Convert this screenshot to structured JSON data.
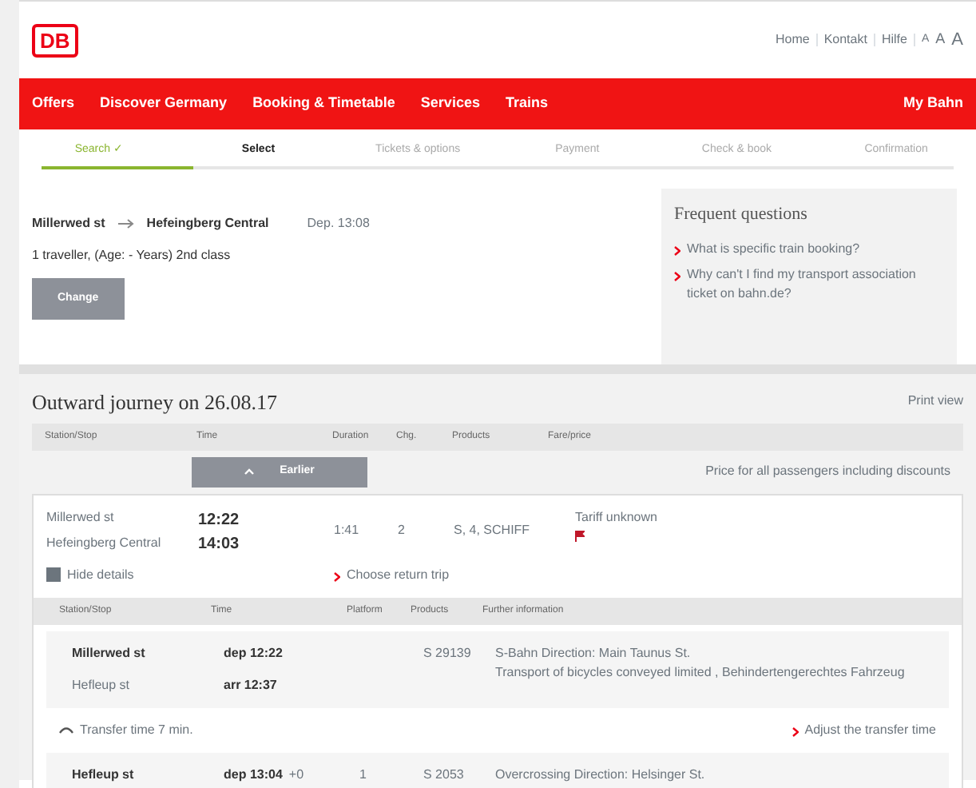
{
  "header": {
    "logo": "DB",
    "links": [
      "Home",
      "Kontakt",
      "Hilfe"
    ],
    "font_sizes": [
      "A",
      "A",
      "A"
    ]
  },
  "nav": {
    "items": [
      "Offers",
      "Discover Germany",
      "Booking & Timetable",
      "Services",
      "Trains"
    ],
    "account": "My Bahn"
  },
  "steps": [
    {
      "label": "Search",
      "done": true,
      "selected": false,
      "check": "✓"
    },
    {
      "label": "Select",
      "done": false,
      "selected": true
    },
    {
      "label": "Tickets & options",
      "done": false,
      "selected": false
    },
    {
      "label": "Payment",
      "done": false,
      "selected": false
    },
    {
      "label": "Check & book",
      "done": false,
      "selected": false
    },
    {
      "label": "Confirmation",
      "done": false,
      "selected": false
    }
  ],
  "summary": {
    "from": "Millerwed st",
    "to": "Hefeingberg Central",
    "departure": "Dep. 13:08",
    "travellers": "1 traveller, (Age: - Years) 2nd class",
    "button": "Change"
  },
  "faq": {
    "title": "Frequent questions",
    "items": [
      "What is specific train booking?",
      "Why can't I find my transport association ticket on bahn.de?"
    ]
  },
  "journey": {
    "title": "Outward journey on 26.08.17",
    "print": "Print view",
    "columns": [
      "Station/Stop",
      "Time",
      "Duration",
      "Chg.",
      "Products",
      "Fare/price"
    ],
    "earlier": "Earlier",
    "price_note": "Price for all passengers including discounts",
    "connection": {
      "from": "Millerwed st",
      "to": "Hefeingberg Central",
      "dep": "12:22",
      "arr": "14:03",
      "duration": "1:41",
      "changes": "2",
      "products": "S, 4, SCHIFF",
      "fare": "Tariff unknown",
      "hide": "Hide details",
      "return": "Choose return trip"
    },
    "detail_columns": [
      "Station/Stop",
      "Time",
      "Platform",
      "Products",
      "Further information"
    ],
    "legs": [
      {
        "kind": "leg",
        "from": "Millerwed st",
        "to": "Hefleup st",
        "dep": "dep 12:22",
        "arr": "arr 12:37",
        "product": "S 29139",
        "info": [
          "S-Bahn Direction: Main Taunus St.",
          "Transport of bicycles conveyed limited , Behindertengerechtes Fahrzeug"
        ]
      },
      {
        "kind": "transfer",
        "text": "Transfer time 7 min.",
        "link": "Adjust the transfer time"
      },
      {
        "kind": "leg",
        "from": "Hefleup st",
        "dep": "dep 13:04",
        "delay": "+0",
        "platform": "1",
        "product": "S 2053",
        "info": [
          "Overcrossing Direction: Helsinger St."
        ]
      }
    ]
  }
}
